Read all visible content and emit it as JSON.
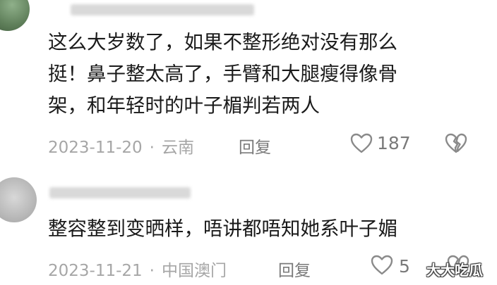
{
  "comments": [
    {
      "lines": [
        "这么大岁数了，如果不整形绝对没有那么",
        "挺！鼻子整太高了，手臂和大腿瘦得像骨",
        "架，和年轻时的叶子楣判若两人"
      ],
      "date": "2023-11-20",
      "location": "云南",
      "reply_label": "回复",
      "likes": "187",
      "icons": {
        "like": "heart-icon",
        "dislike": "broken-heart-icon"
      }
    },
    {
      "lines": [
        "整容整到变晒样，唔讲都唔知她系叶子媚"
      ],
      "date": "2023-11-21",
      "location": "中国澳门",
      "reply_label": "回复",
      "likes": "5",
      "icons": {
        "like": "heart-icon",
        "dislike": "broken-heart-icon"
      }
    }
  ],
  "separator": "·",
  "watermark": "大大吃瓜"
}
